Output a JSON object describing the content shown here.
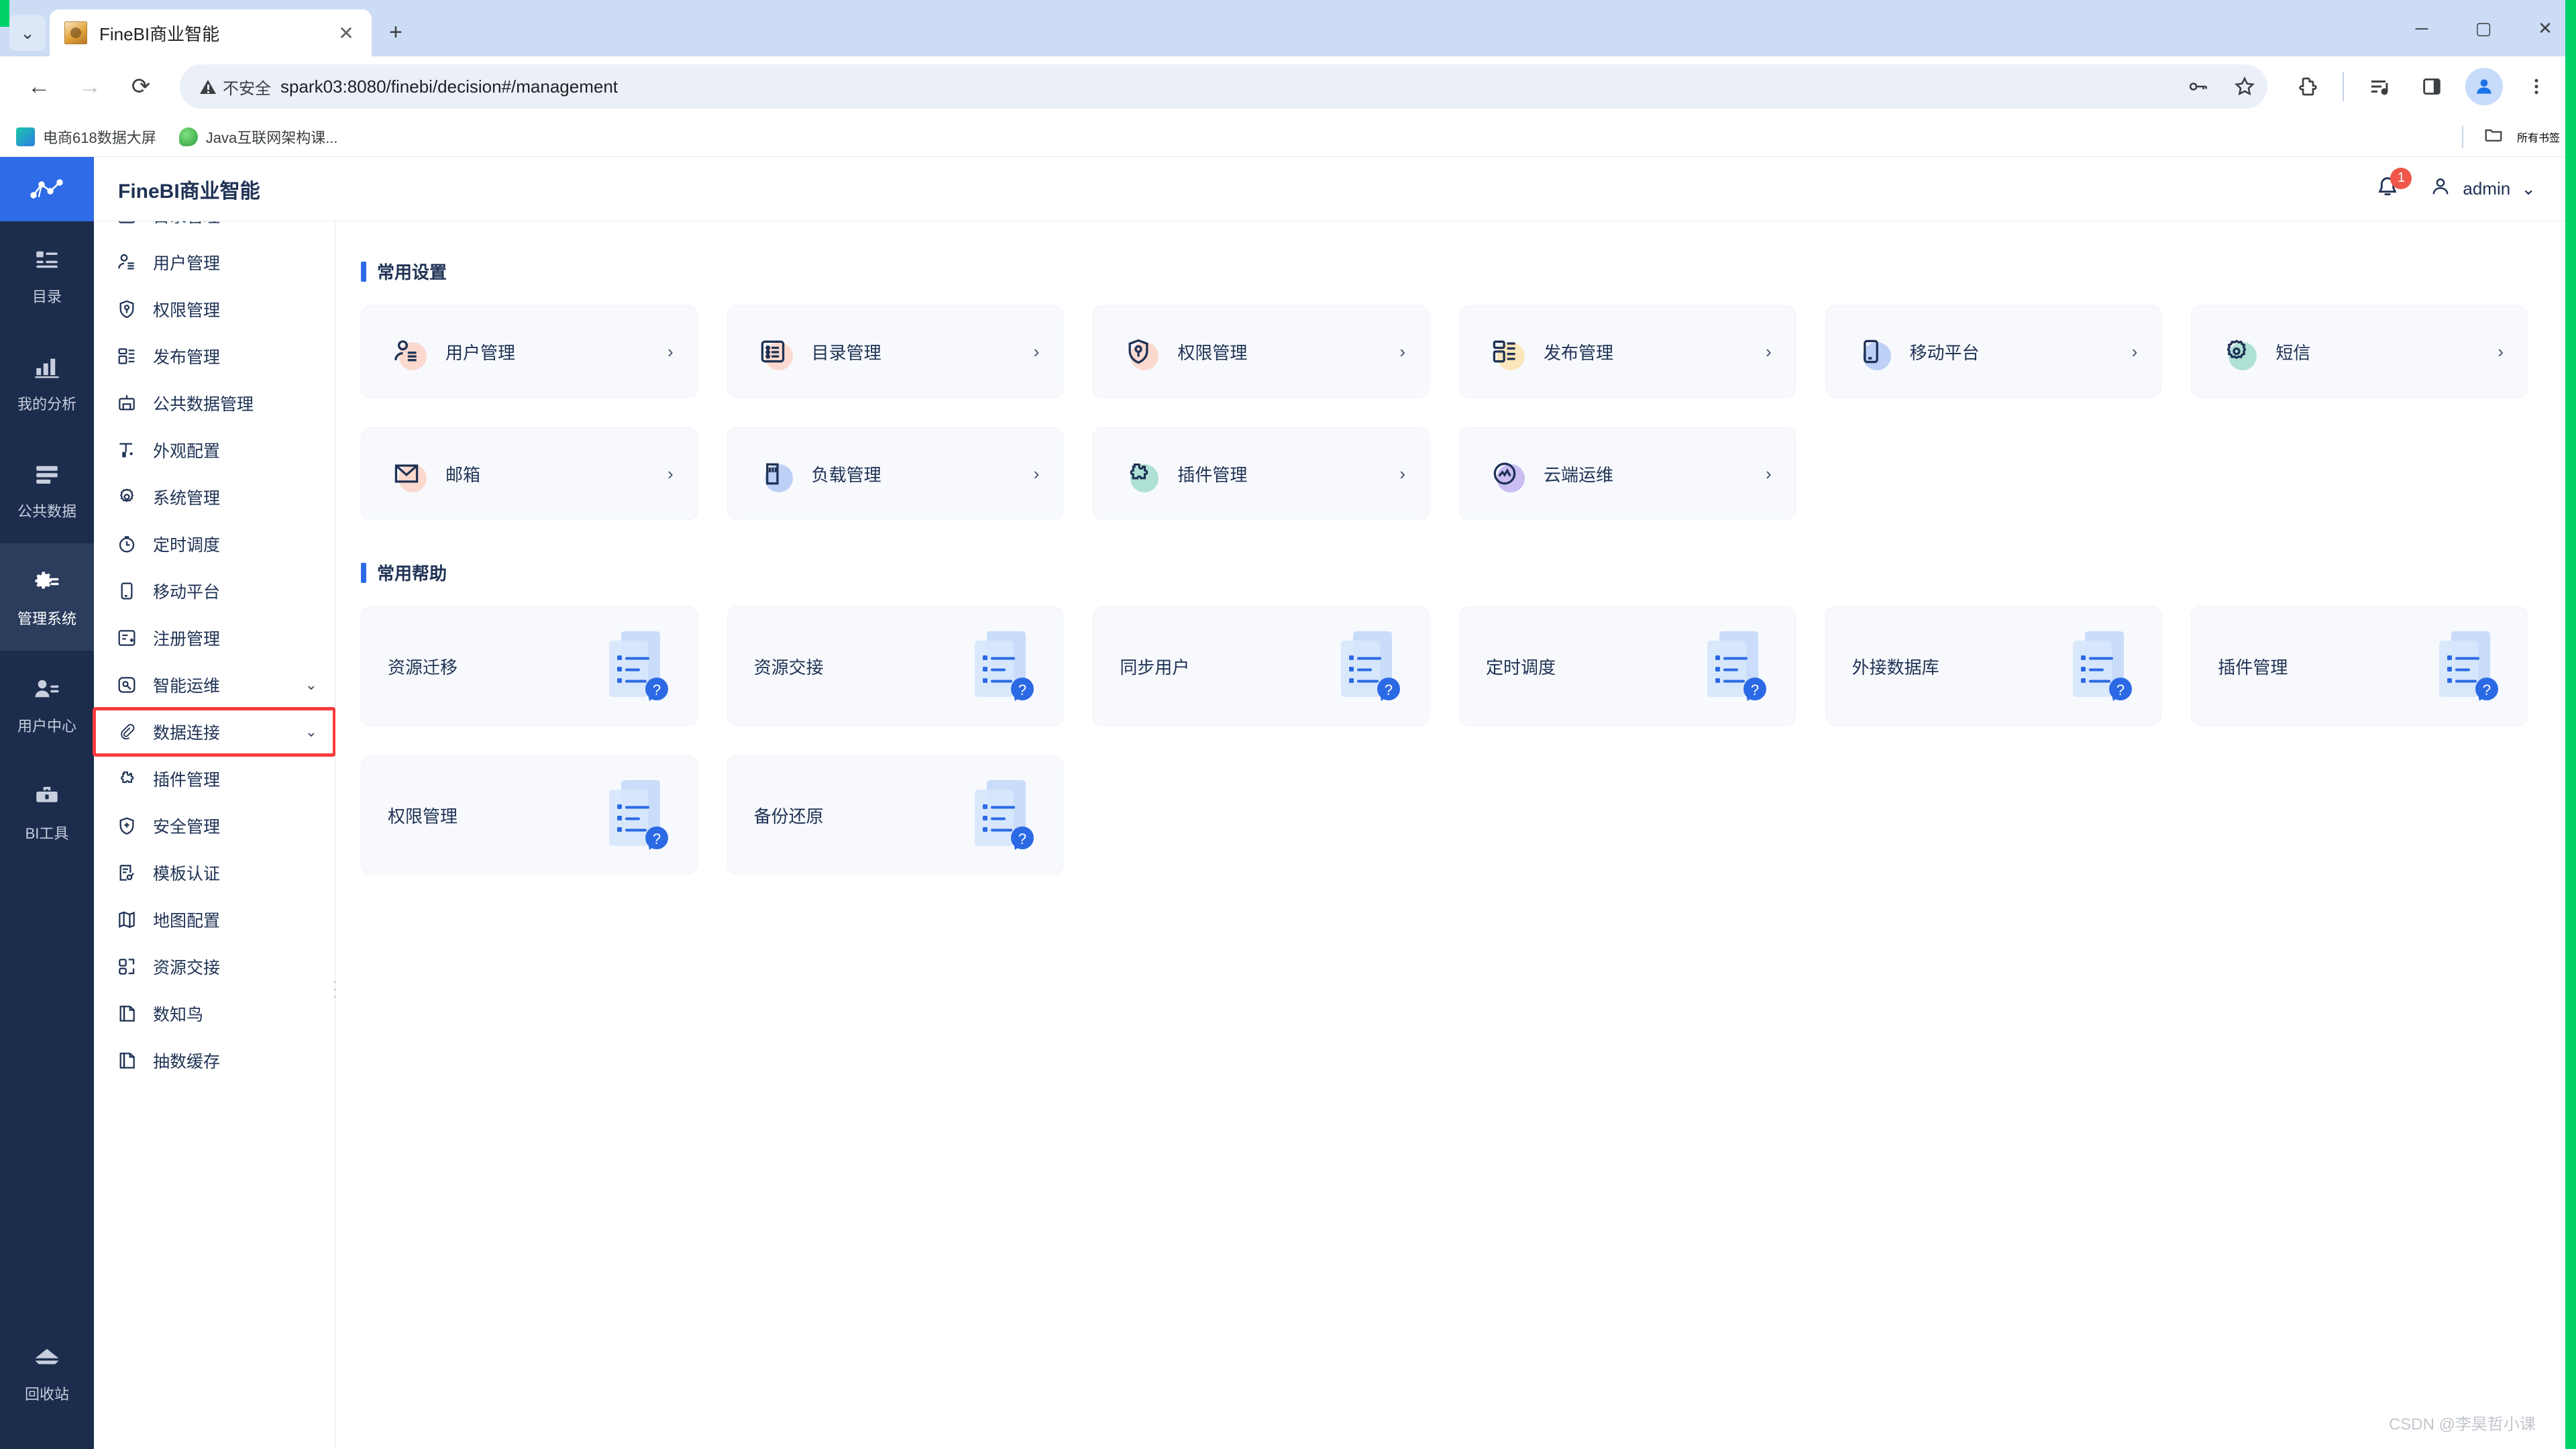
{
  "browser": {
    "tab": {
      "title": "FineBI商业智能",
      "close_label": "✕"
    },
    "newtab_label": "+",
    "tablist_label": "⌄",
    "nav": {
      "back": "←",
      "forward": "→",
      "reload": "⟳"
    },
    "security": {
      "label": "不安全"
    },
    "url": "spark03:8080/finebi/decision#/management",
    "omnibox_icons": [
      "password-key-icon",
      "bookmark-star-icon"
    ],
    "toolbar_icons": [
      "extensions-icon",
      "media-control-icon",
      "side-panel-icon",
      "profile-avatar-icon",
      "chrome-menu-icon"
    ],
    "bookmarks": [
      {
        "label": "电商618数据大屏",
        "icon": "finebi-dashboard-icon"
      },
      {
        "label": "Java互联网架构课...",
        "icon": "java-course-icon"
      }
    ],
    "all_bookmarks_label": "所有书签",
    "window_controls": {
      "minimize": "─",
      "maximize": "▢",
      "close": "✕"
    }
  },
  "rail": {
    "logo_name": "finebi-logo",
    "items": [
      {
        "label": "目录",
        "icon": "directory-icon",
        "active": false
      },
      {
        "label": "我的分析",
        "icon": "analysis-chart-icon",
        "active": false
      },
      {
        "label": "公共数据",
        "icon": "public-data-icon",
        "active": false
      },
      {
        "label": "管理系统",
        "icon": "gear-system-icon",
        "active": true
      },
      {
        "label": "用户中心",
        "icon": "user-center-icon",
        "active": false
      },
      {
        "label": "BI工具",
        "icon": "toolbox-icon",
        "active": false
      }
    ],
    "bottom": {
      "label": "回收站",
      "icon": "recycle-bin-icon"
    }
  },
  "submenu": {
    "items": [
      {
        "label": "目录管理",
        "icon": "list-box-icon",
        "chevron": ""
      },
      {
        "label": "用户管理",
        "icon": "user-lines-icon",
        "chevron": ""
      },
      {
        "label": "权限管理",
        "icon": "shield-key-icon",
        "chevron": ""
      },
      {
        "label": "发布管理",
        "icon": "publish-layout-icon",
        "chevron": ""
      },
      {
        "label": "公共数据管理",
        "icon": "database-public-icon",
        "chevron": ""
      },
      {
        "label": "外观配置",
        "icon": "appearance-icon",
        "chevron": ""
      },
      {
        "label": "系统管理",
        "icon": "gear-icon",
        "chevron": ""
      },
      {
        "label": "定时调度",
        "icon": "timer-icon",
        "chevron": ""
      },
      {
        "label": "移动平台",
        "icon": "mobile-icon",
        "chevron": ""
      },
      {
        "label": "注册管理",
        "icon": "register-icon",
        "chevron": ""
      },
      {
        "label": "智能运维",
        "icon": "ops-wrench-icon",
        "chevron": "⌄"
      },
      {
        "label": "数据连接",
        "icon": "paperclip-icon",
        "chevron": "⌄",
        "highlighted": true
      },
      {
        "label": "插件管理",
        "icon": "puzzle-icon",
        "chevron": ""
      },
      {
        "label": "安全管理",
        "icon": "shield-plus-icon",
        "chevron": ""
      },
      {
        "label": "模板认证",
        "icon": "template-auth-icon",
        "chevron": ""
      },
      {
        "label": "地图配置",
        "icon": "map-icon",
        "chevron": ""
      },
      {
        "label": "资源交接",
        "icon": "resource-handover-icon",
        "chevron": ""
      },
      {
        "label": "数知鸟",
        "icon": "doc-copy-icon",
        "chevron": ""
      },
      {
        "label": "抽数缓存",
        "icon": "doc-copy-icon",
        "chevron": ""
      }
    ]
  },
  "header": {
    "title": "FineBI商业智能",
    "notification_count": "1",
    "bell_icon": "bell-icon",
    "user_icon": "user-icon",
    "username": "admin",
    "user_chevron": "⌄"
  },
  "sections": {
    "settings": {
      "title": "常用设置",
      "chevron": "›",
      "cards": [
        {
          "label": "用户管理",
          "icon": "user-lines-icon",
          "blob": "#fbd9cf"
        },
        {
          "label": "目录管理",
          "icon": "list-box-icon",
          "blob": "#fbd9cf"
        },
        {
          "label": "权限管理",
          "icon": "shield-key-icon",
          "blob": "#fbd9cf"
        },
        {
          "label": "发布管理",
          "icon": "publish-layout-icon",
          "blob": "#fbe6bb"
        },
        {
          "label": "移动平台",
          "icon": "mobile-icon",
          "blob": "#bdd0f6"
        },
        {
          "label": "短信",
          "icon": "sms-gear-icon",
          "blob": "#aee0d5"
        },
        {
          "label": "邮箱",
          "icon": "mail-icon",
          "blob": "#fbd9cf"
        },
        {
          "label": "负载管理",
          "icon": "load-icon",
          "blob": "#bdd0f6"
        },
        {
          "label": "插件管理",
          "icon": "puzzle-icon",
          "blob": "#aee0d5"
        },
        {
          "label": "云端运维",
          "icon": "cloud-ops-icon",
          "blob": "#c9bdf2"
        }
      ]
    },
    "help": {
      "title": "常用帮助",
      "art_icon": "help-document-icon",
      "badge_glyph": "?",
      "cards": [
        {
          "label": "资源迁移"
        },
        {
          "label": "资源交接"
        },
        {
          "label": "同步用户"
        },
        {
          "label": "定时调度"
        },
        {
          "label": "外接数据库"
        },
        {
          "label": "插件管理"
        },
        {
          "label": "权限管理"
        },
        {
          "label": "备份还原"
        }
      ]
    }
  },
  "watermark": "CSDN @李昊哲小课",
  "colors": {
    "accent": "#2b6ae4",
    "rail_bg": "#1c2c4c",
    "card_bg": "#f7f9fd",
    "highlight_red": "#fa3b3b",
    "badge_red": "#f0564a"
  }
}
